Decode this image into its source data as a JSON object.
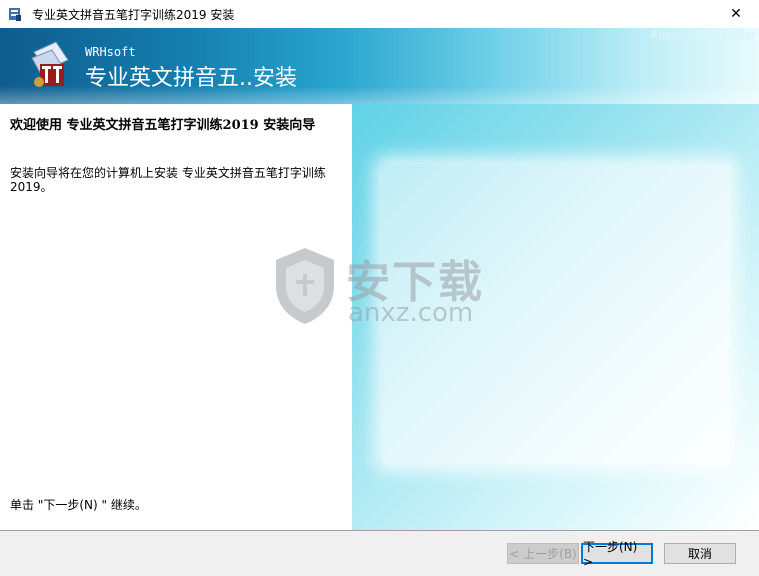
{
  "window": {
    "title": "专业英文拼音五笔打字训练2019 安装",
    "close_glyph": "✕"
  },
  "banner": {
    "company": "WRHsoft",
    "title": "专业英文拼音五..安装",
    "brand": "Advanced Installer"
  },
  "content": {
    "welcome_title": "欢迎使用 专业英文拼音五笔打字训练2019 安装向导",
    "description": "安装向导将在您的计算机上安装 专业英文拼音五笔打字训练2019。",
    "continue_hint": "单击 \"下一步(N) \" 继续。"
  },
  "watermark": {
    "name": "安下载",
    "url": "anxz.com"
  },
  "buttons": {
    "back": "< 上一步(B)",
    "next": "下一步(N) >",
    "cancel": "取消"
  },
  "colors": {
    "banner_dark": "#0f5c8c",
    "art_cyan": "#5fd2e6",
    "accent_focus": "#0078d7"
  },
  "icons": {
    "app": "installer-icon",
    "close": "close-icon",
    "logo": "product-logo-icon",
    "watermark": "shield-icon"
  }
}
